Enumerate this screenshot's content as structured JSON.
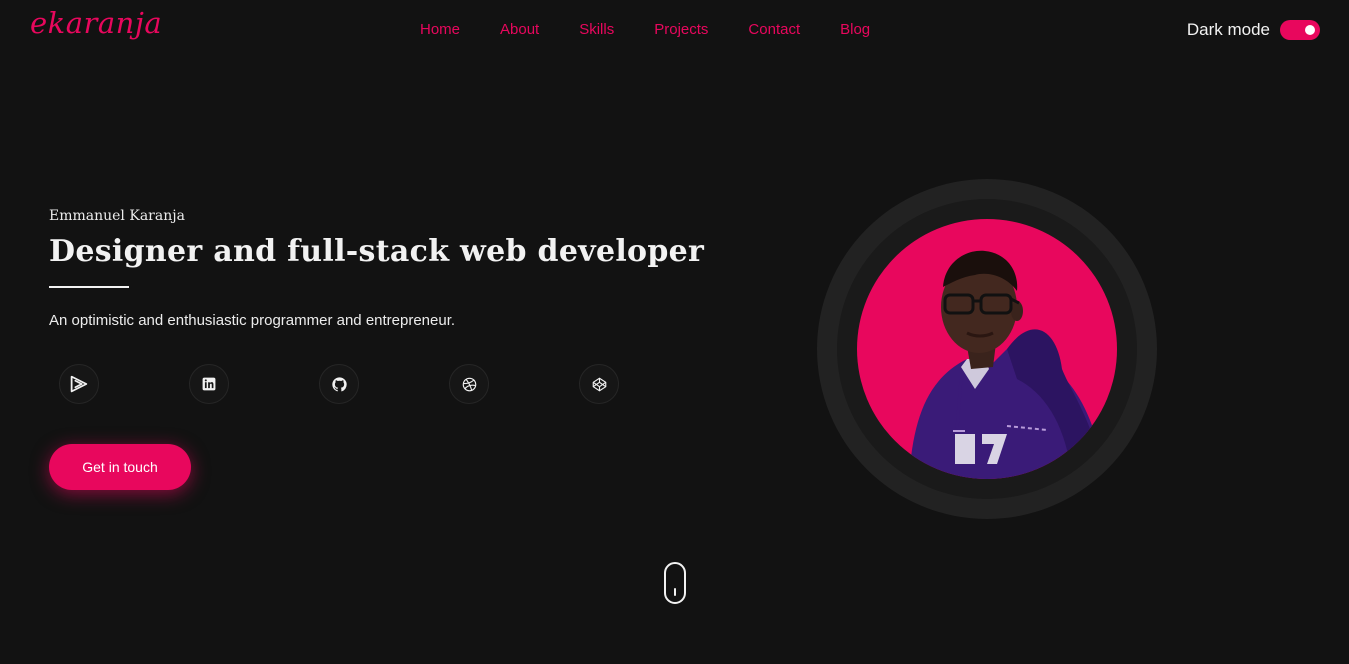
{
  "header": {
    "logo": "ekaranja",
    "nav": [
      "Home",
      "About",
      "Skills",
      "Projects",
      "Contact",
      "Blog"
    ],
    "dark_mode_label": "Dark mode",
    "dark_mode_on": true
  },
  "hero": {
    "name": "Emmanuel Karanja",
    "title": "Designer and full-stack web developer",
    "description": "An optimistic and enthusiastic programmer and entrepreneur.",
    "socials": [
      {
        "icon": "play-icon"
      },
      {
        "icon": "linkedin-icon"
      },
      {
        "icon": "github-icon"
      },
      {
        "icon": "dribbble-icon"
      },
      {
        "icon": "codepen-icon"
      }
    ],
    "cta_label": "Get in touch"
  },
  "colors": {
    "background": "#121212",
    "accent": "#e8075d",
    "text": "#f2f2f2"
  }
}
